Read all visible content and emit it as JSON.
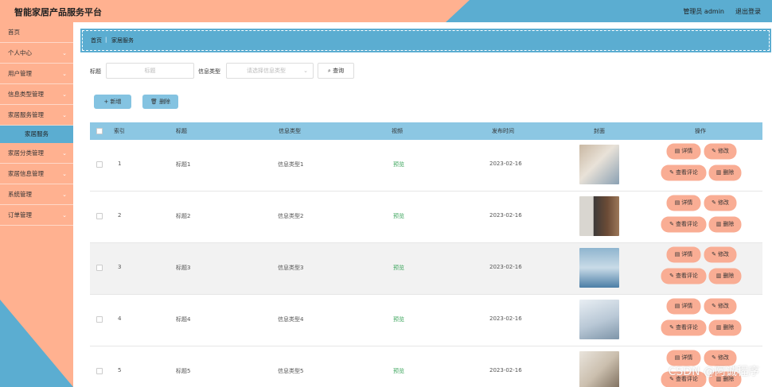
{
  "header": {
    "app_title": "智能家居产品服务平台",
    "admin_label": "管理员 admin",
    "logout_label": "退出登录"
  },
  "sidebar": {
    "items": [
      {
        "label": "首页",
        "has_arrow": false
      },
      {
        "label": "个人中心",
        "has_arrow": true
      },
      {
        "label": "用户管理",
        "has_arrow": true
      },
      {
        "label": "信息类型管理",
        "has_arrow": true
      },
      {
        "label": "家居服务管理",
        "has_arrow": true
      }
    ],
    "active_sub": "家居服务",
    "items_after": [
      {
        "label": "家居分类管理",
        "has_arrow": true
      },
      {
        "label": "家居信息管理",
        "has_arrow": true
      },
      {
        "label": "系统管理",
        "has_arrow": true
      },
      {
        "label": "订单管理",
        "has_arrow": true
      }
    ]
  },
  "breadcrumb": {
    "home": "首页",
    "current": "家居服务"
  },
  "search": {
    "title_label": "标题",
    "title_placeholder": "标题",
    "type_label": "信息类型",
    "type_placeholder": "请选择信息类型",
    "query_label": "查询"
  },
  "actions": {
    "add_label": "新增",
    "delete_label": "删除"
  },
  "table": {
    "headers": [
      "索引",
      "标题",
      "信息类型",
      "视频",
      "发布时间",
      "封面",
      "操作"
    ],
    "rows": [
      {
        "index": "1",
        "title": "标题1",
        "type": "信息类型1",
        "video": "预览",
        "date": "2023-02-16",
        "cover": "smart-home-tablet"
      },
      {
        "index": "2",
        "title": "标题2",
        "type": "信息类型2",
        "video": "预览",
        "date": "2023-02-16",
        "cover": "smart-door-lock"
      },
      {
        "index": "3",
        "title": "标题3",
        "type": "信息类型3",
        "video": "预览",
        "date": "2023-02-16",
        "cover": "smart-bed-room"
      },
      {
        "index": "4",
        "title": "标题4",
        "type": "信息类型4",
        "video": "预览",
        "date": "2023-02-16",
        "cover": "smart-home-devices"
      },
      {
        "index": "5",
        "title": "标题5",
        "type": "信息类型5",
        "video": "预览",
        "date": "2023-02-16",
        "cover": "smart-living-room"
      }
    ],
    "op_labels": {
      "detail": "详情",
      "edit": "修改",
      "comments": "查看评论",
      "delete": "删除"
    }
  },
  "watermark": "CSDN @阿诚程序",
  "colors": {
    "accent_blue": "#5badd1",
    "accent_salmon": "#ffb190",
    "header_row": "#8cc7e3",
    "op_button": "#f9ad94",
    "video_link": "#3ca55c"
  }
}
